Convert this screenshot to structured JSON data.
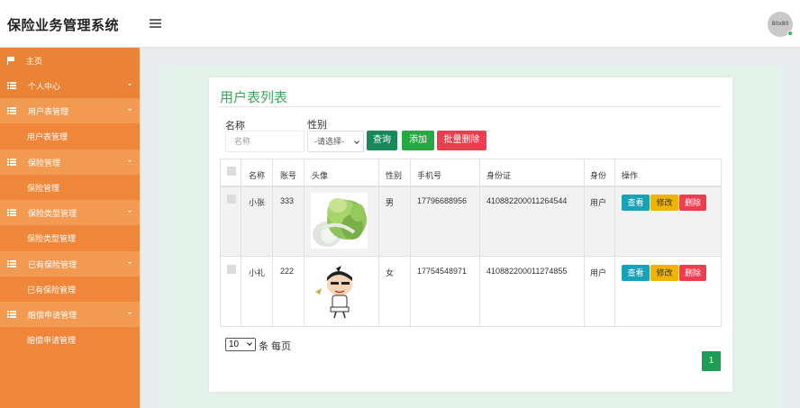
{
  "app": {
    "title": "保险业务管理系统",
    "avatar_text": "80x80"
  },
  "sidebar": {
    "home": "主页",
    "groups": [
      {
        "label": "个人中心",
        "sub": null
      },
      {
        "label": "用户表管理",
        "sub": "用户表管理"
      },
      {
        "label": "保险管理",
        "sub": "保险管理"
      },
      {
        "label": "保险类型管理",
        "sub": "保险类型管理"
      },
      {
        "label": "已有保险管理",
        "sub": "已有保险管理"
      },
      {
        "label": "赔偿申请管理",
        "sub": "赔偿申请管理"
      }
    ]
  },
  "page": {
    "title": "用户表列表",
    "search": {
      "name_label": "名称",
      "name_placeholder": "名称",
      "gender_label": "性别",
      "gender_selected": "-请选择-"
    },
    "buttons": {
      "query": "查询",
      "add": "添加",
      "batch_delete": "批量删除"
    },
    "table": {
      "headers": [
        "名称",
        "账号",
        "头像",
        "性别",
        "手机号",
        "身份证",
        "身份",
        "操作"
      ],
      "rows": [
        {
          "name": "小张",
          "account": "333",
          "avatar": "cabbage-image",
          "gender": "男",
          "phone": "17796688956",
          "id_card": "410882200011264544",
          "role": "用户"
        },
        {
          "name": "小礼",
          "account": "222",
          "avatar": "cartoon-boy-image",
          "gender": "女",
          "phone": "17754548971",
          "id_card": "410882200011274855",
          "role": "用户"
        }
      ],
      "actions": {
        "view": "查看",
        "edit": "修改",
        "delete": "删除"
      }
    },
    "pagination": {
      "page_size": "10",
      "page_size_label": "条 每页",
      "current_page": "1"
    }
  },
  "colors": {
    "sidebar": "#f0863a",
    "accent_green": "#1e9e54",
    "title_green": "#3aa55a",
    "info": "#17a2b8",
    "warning": "#f0b400",
    "danger": "#ee3d4f"
  }
}
